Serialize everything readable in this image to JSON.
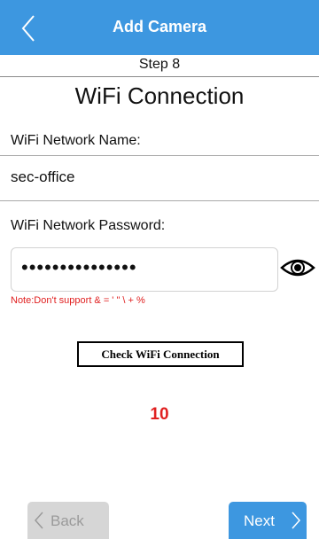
{
  "header": {
    "title": "Add Camera",
    "back_icon": "chevron-left-icon",
    "color": "#3d97e0"
  },
  "step": "Step 8",
  "section_title": "WiFi Connection",
  "ssid": {
    "label": "WiFi Network Name:",
    "value": "sec-office"
  },
  "password": {
    "label": "WiFi Network Password:",
    "value": "•••••••••••••••",
    "toggle_icon": "eye-icon"
  },
  "note": "Note:Don't support & = ' \" \\ + %",
  "check_button": "Check WiFi Connection",
  "countdown": "10",
  "footer": {
    "back_label": "Back",
    "next_label": "Next"
  },
  "colors": {
    "accent": "#3d97e0",
    "warning": "#e02020",
    "disabled": "#d6d6d6"
  }
}
